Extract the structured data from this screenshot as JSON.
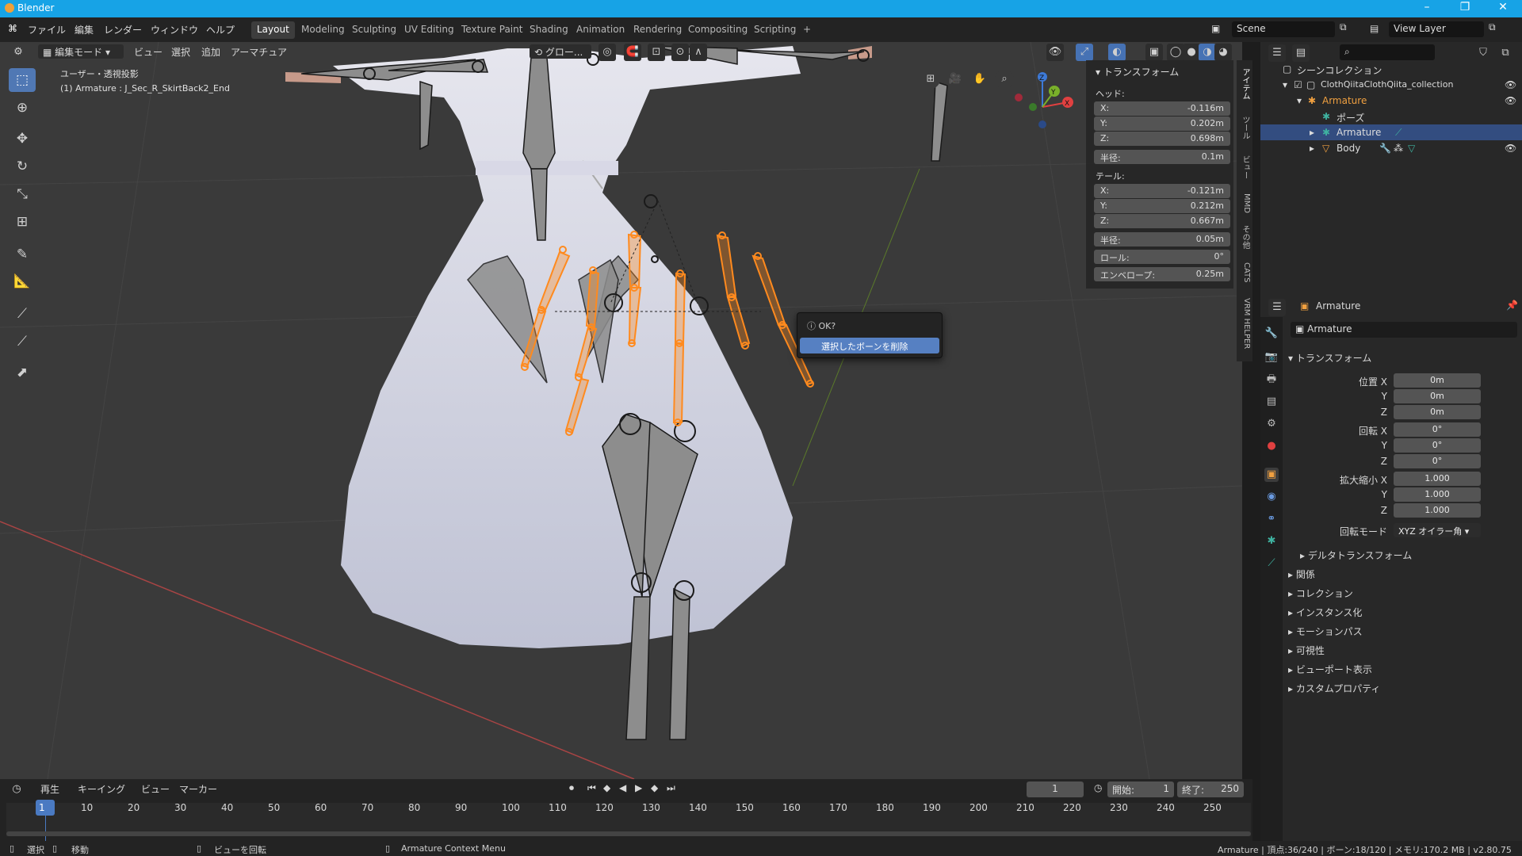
{
  "window": {
    "title": "Blender",
    "controls": [
      "–",
      "❐",
      "✕"
    ]
  },
  "topbar": {
    "menus": [
      "ファイル",
      "編集",
      "レンダー",
      "ウィンドウ",
      "ヘルプ"
    ],
    "workspaces": [
      "Layout",
      "Modeling",
      "Sculpting",
      "UV Editing",
      "Texture Paint",
      "Shading",
      "Animation",
      "Rendering",
      "Compositing",
      "Scripting",
      "+"
    ],
    "active_workspace": "Layout",
    "scene": "Scene",
    "view_layer": "View Layer"
  },
  "viewport_header": {
    "mode": "編集モード",
    "menus": [
      "ビュー",
      "選択",
      "追加",
      "アーマチュア"
    ],
    "orientation": "グロー..."
  },
  "viewport": {
    "view_name": "ユーザー・透視投影",
    "object_info": "(1) Armature : J_Sec_R_SkirtBack2_End",
    "gizmo_axes": {
      "x": "X",
      "y": "Y",
      "z": "Z"
    }
  },
  "npanel": {
    "title": "トランスフォーム",
    "head_label": "ヘッド:",
    "head": [
      {
        "axis": "X:",
        "value": "-0.116m"
      },
      {
        "axis": "Y:",
        "value": "0.202m"
      },
      {
        "axis": "Z:",
        "value": "0.698m"
      }
    ],
    "head_radius": {
      "label": "半径:",
      "value": "0.1m"
    },
    "tail_label": "テール:",
    "tail": [
      {
        "axis": "X:",
        "value": "-0.121m"
      },
      {
        "axis": "Y:",
        "value": "0.212m"
      },
      {
        "axis": "Z:",
        "value": "0.667m"
      }
    ],
    "tail_radius": {
      "label": "半径:",
      "value": "0.05m"
    },
    "roll": {
      "label": "ロール:",
      "value": "0°"
    },
    "envelope": {
      "label": "エンベロープ:",
      "value": "0.25m"
    },
    "tabs": [
      "アイテム",
      "ツール",
      "ビュー",
      "MMD",
      "その他",
      "CATS",
      "VRM HELPER"
    ]
  },
  "popup": {
    "question": "OK?",
    "action": "選択したボーンを削除"
  },
  "outliner": {
    "search_placeholder": "",
    "rows": [
      {
        "label": "シーンコレクション"
      },
      {
        "label": "ClothQiitaClothQiita_collection"
      },
      {
        "label": "Armature"
      },
      {
        "label": "ポーズ"
      },
      {
        "label": "Armature"
      },
      {
        "label": "Body"
      }
    ]
  },
  "properties": {
    "object_name": "Armature",
    "data_name": "Armature",
    "section": "トランスフォーム",
    "location": {
      "label": "位置 X",
      "values": [
        "0m",
        "0m",
        "0m"
      ]
    },
    "rotation": {
      "label": "回転 X",
      "values": [
        "0°",
        "0°",
        "0°"
      ]
    },
    "scale": {
      "label": "拡大縮小 X",
      "values": [
        "1.000",
        "1.000",
        "1.000"
      ]
    },
    "axis_labels": [
      "Y",
      "Z"
    ],
    "rotation_mode": {
      "label": "回転モード",
      "value": "XYZ オイラー角"
    },
    "delta": "デルタトランスフォーム",
    "sections": [
      "関係",
      "コレクション",
      "インスタンス化",
      "モーションパス",
      "可視性",
      "ビューポート表示",
      "カスタムプロパティ"
    ]
  },
  "timeline": {
    "menus": [
      "再生",
      "キーイング",
      "ビュー",
      "マーカー"
    ],
    "current_frame": "1",
    "start": {
      "label": "開始:",
      "value": "1"
    },
    "end": {
      "label": "終了:",
      "value": "250"
    },
    "ticks": [
      "1",
      "10",
      "20",
      "30",
      "40",
      "50",
      "60",
      "70",
      "80",
      "90",
      "100",
      "110",
      "120",
      "130",
      "140",
      "150",
      "160",
      "170",
      "180",
      "190",
      "200",
      "210",
      "220",
      "230",
      "240",
      "250"
    ]
  },
  "statusbar": {
    "select": "選択",
    "move": "移動",
    "rotate_view": "ビューを回転",
    "context_menu": "Armature Context Menu",
    "stats": "Armature | 頂点:36/240 | ボーン:18/120 | メモリ:170.2 MB | v2.80.75"
  },
  "colors": {
    "accent": "#5680c2",
    "selected_bone": "#ff8a1e",
    "titlebar": "#17a3e6",
    "armature_icon": "#f0a040"
  }
}
